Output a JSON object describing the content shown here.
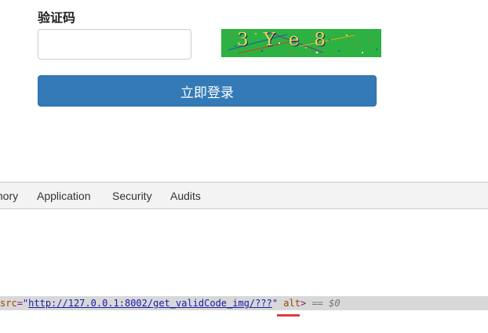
{
  "form": {
    "captcha_label": "验证码",
    "captcha_input_value": "",
    "captcha_text": "3Ye8",
    "login_button_label": "立即登录"
  },
  "colors": {
    "captcha_bg": "#2eb143",
    "button_bg": "#337ab7",
    "selected_line_bg": "#d8d8d8",
    "highlight_underline": "#e03a3a"
  },
  "devtools": {
    "tabs": [
      "mory",
      "Application",
      "Security",
      "Audits"
    ],
    "element_line": {
      "attr_name": "src",
      "equals": "=",
      "quote": "\"",
      "url": "http://127.0.0.1:8002/get_validCode_img/???",
      "next_attr": "alt",
      "tag_close": ">",
      "console_ref_prefix": "==",
      "console_ref": "$0"
    }
  }
}
